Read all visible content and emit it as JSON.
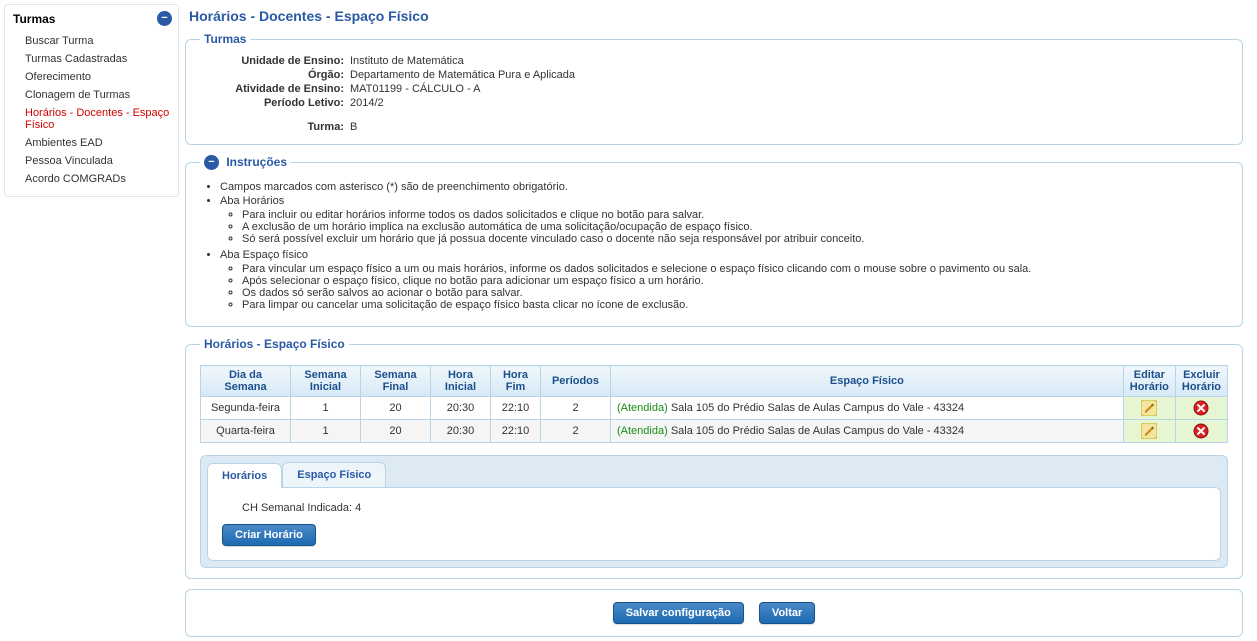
{
  "sidebar": {
    "title": "Turmas",
    "items": [
      {
        "label": "Buscar Turma"
      },
      {
        "label": "Turmas Cadastradas"
      },
      {
        "label": "Oferecimento"
      },
      {
        "label": "Clonagem de Turmas"
      },
      {
        "label": "Horários - Docentes - Espaço Físico"
      },
      {
        "label": "Ambientes EAD"
      },
      {
        "label": "Pessoa Vinculada"
      },
      {
        "label": "Acordo COMGRADs"
      }
    ],
    "activeIndex": 4
  },
  "page": {
    "title": "Horários - Docentes - Espaço Físico"
  },
  "turmas_box": {
    "legend": "Turmas",
    "unidade_label": "Unidade de Ensino:",
    "unidade": "Instituto de Matemática",
    "orgao_label": "Órgão:",
    "orgao": "Departamento de Matemática Pura e Aplicada",
    "atividade_label": "Atividade de Ensino:",
    "atividade": "MAT01199 - CÁLCULO - A",
    "periodo_label": "Período Letivo:",
    "periodo": "2014/2",
    "turma_label": "Turma:",
    "turma": "B"
  },
  "instrucoes": {
    "legend": "Instruções",
    "top": [
      "Campos marcados com asterisco (*) são de preenchimento obrigatório.",
      "Aba Horários",
      "Aba Espaço físico"
    ],
    "sub_horarios": [
      "Para incluir ou editar horários informe todos os dados solicitados e clique no botão para salvar.",
      "A exclusão de um horário implica na exclusão automática de uma solicitação/ocupação de espaço físico.",
      "Só será possível excluir um horário que já possua docente vinculado caso o docente não seja responsável por atribuir conceito."
    ],
    "sub_espaco": [
      "Para vincular um espaço físico a um ou mais horários, informe os dados solicitados e selecione o espaço físico clicando com o mouse sobre o pavimento ou sala.",
      "Após selecionar o espaço físico, clique no botão para adicionar um espaço físico a um horário.",
      "Os dados só serão salvos ao acionar o botão para salvar.",
      "Para limpar ou cancelar uma solicitação de espaço físico basta clicar no ícone de exclusão."
    ]
  },
  "schedule_box": {
    "legend": "Horários - Espaço Físico",
    "headers": {
      "dia": "Dia da Semana",
      "sem_ini": "Semana Inicial",
      "sem_fim": "Semana Final",
      "hora_ini": "Hora Inicial",
      "hora_fim": "Hora Fim",
      "periodos": "Períodos",
      "espaco": "Espaço Físico",
      "editar": "Editar Horário",
      "excluir": "Excluir Horário"
    },
    "rows": [
      {
        "dia": "Segunda-feira",
        "sem_ini": "1",
        "sem_fim": "20",
        "hora_ini": "20:30",
        "hora_fim": "22:10",
        "periodos": "2",
        "espaco_status": "(Atendida)",
        "espaco_desc": "Sala 105 do Prédio Salas de Aulas Campus do Vale - 43324"
      },
      {
        "dia": "Quarta-feira",
        "sem_ini": "1",
        "sem_fim": "20",
        "hora_ini": "20:30",
        "hora_fim": "22:10",
        "periodos": "2",
        "espaco_status": "(Atendida)",
        "espaco_desc": "Sala 105 do Prédio Salas de Aulas Campus do Vale - 43324"
      }
    ]
  },
  "tabs": {
    "horarios": "Horários",
    "espaco": "Espaço Físico",
    "activeIndex": 0,
    "panel": {
      "ch_label": "CH Semanal Indicada:",
      "ch_value": "4",
      "criar_btn": "Criar Horário"
    }
  },
  "actions": {
    "save": "Salvar configuração",
    "back": "Voltar"
  }
}
